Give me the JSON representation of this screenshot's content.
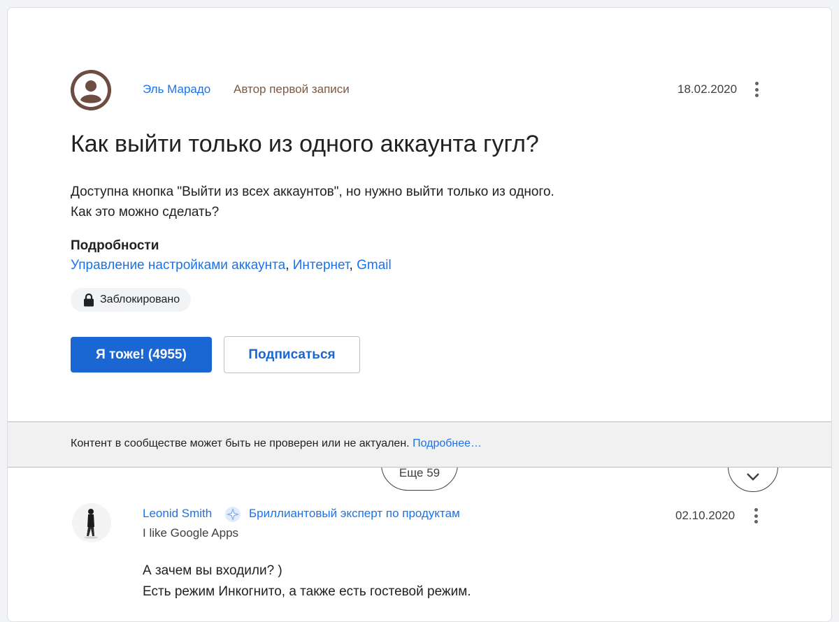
{
  "question": {
    "author_name": "Эль Марадо",
    "author_role": "Автор первой записи",
    "date": "18.02.2020",
    "title": "Как выйти только из одного аккаунта гугл?",
    "body_lines": [
      "Доступна кнопка \"Выйти из всех аккаунтов\", но нужно выйти только из одного.",
      "Как это можно сделать?"
    ],
    "details_heading": "Подробности",
    "details_tags": [
      "Управление настройками аккаунта",
      "Интернет",
      "Gmail"
    ],
    "details_separator": ", ",
    "status_chip": "Заблокировано",
    "me_too_button": "Я тоже! (4955)",
    "subscribe_button": "Подписаться"
  },
  "more_replies_label": "Еще 59",
  "notice": {
    "text": "Контент в сообществе может быть не проверен или не актуален.",
    "link": "Подробнее…"
  },
  "reply": {
    "author_name": "Leonid Smith",
    "badge_label": "Бриллиантовый эксперт по продуктам",
    "tagline": "I like Google Apps",
    "date": "02.10.2020",
    "body_lines": [
      "А зачем вы входили? )",
      "Есть режим Инкогнито, а также есть гостевой режим."
    ]
  },
  "icons": {
    "more_options": "more-vert-icon",
    "lock": "lock-icon",
    "expand": "chevron-down-icon",
    "expert_badge": "diamond-expert-badge-icon",
    "default_avatar": "account-circle-icon"
  },
  "colors": {
    "link_blue": "#1a73e8",
    "primary_button": "#1a66d2",
    "author_role_brown": "#7b5a43",
    "avatar_brown": "#6d4c41",
    "notice_bg": "#f1f1f1"
  }
}
